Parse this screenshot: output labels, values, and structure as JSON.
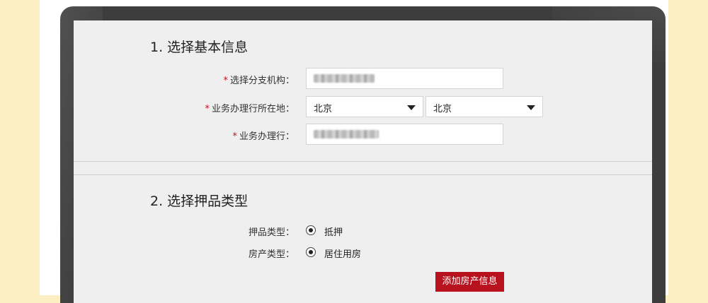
{
  "section1": {
    "title": "1. 选择基本信息",
    "fields": {
      "branch": {
        "required": "*",
        "label": "选择分支机构："
      },
      "location": {
        "required": "*",
        "label": "业务办理行所在地：",
        "province": "北京",
        "city": "北京"
      },
      "bank": {
        "required": "*",
        "label": "业务办理行："
      }
    }
  },
  "section2": {
    "title": "2. 选择押品类型",
    "collateral_type": {
      "label": "押品类型：",
      "option": "抵押"
    },
    "property_type": {
      "label": "房产类型：",
      "option": "居住用房"
    },
    "add_button": "添加房产信息"
  },
  "colors": {
    "background": "#fcefc3",
    "accent": "#b8121e",
    "required": "#c0121e"
  },
  "icons": [
    "radio-selected-icon",
    "dropdown-caret-icon"
  ]
}
